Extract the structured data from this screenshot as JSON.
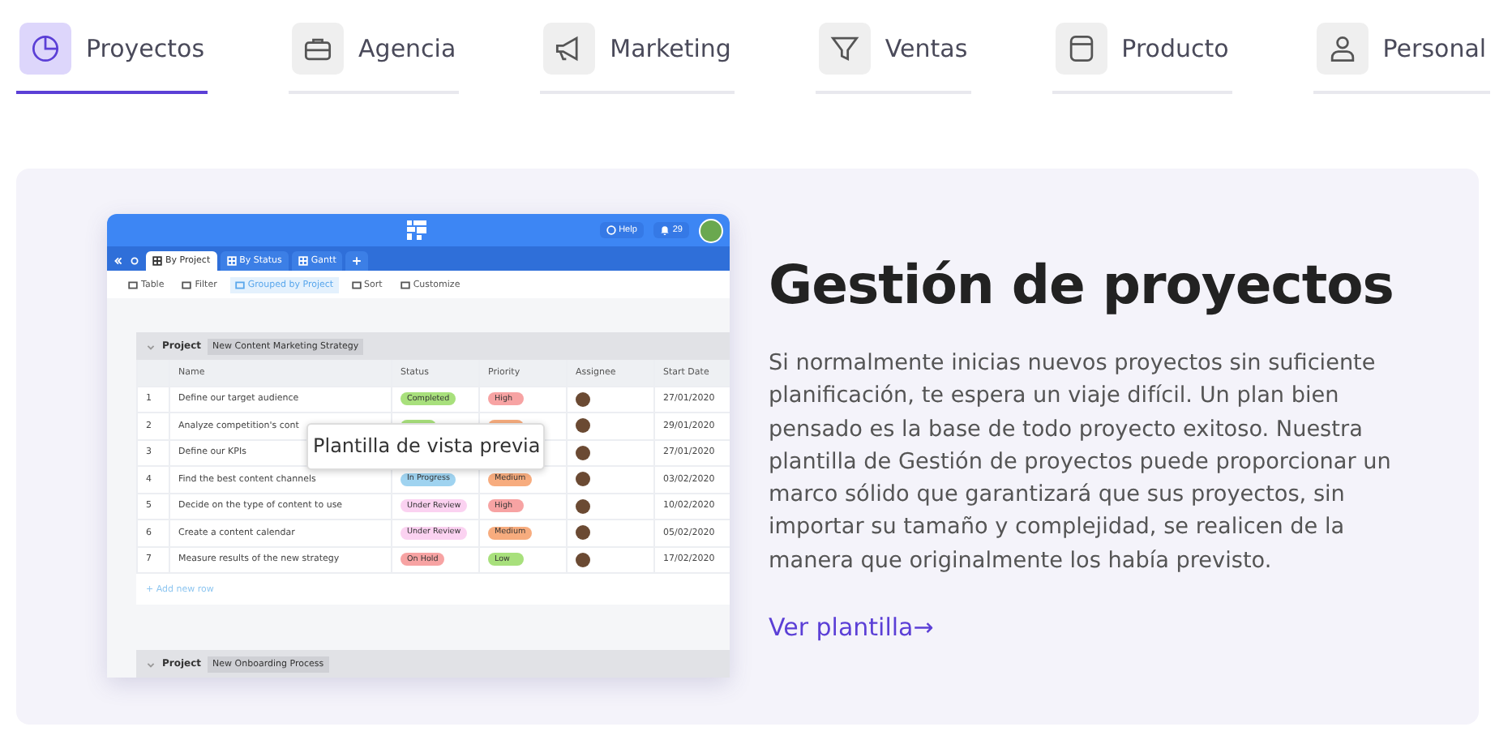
{
  "tabs": [
    {
      "label": "Proyectos",
      "selected": true
    },
    {
      "label": "Agencia",
      "selected": false
    },
    {
      "label": "Marketing",
      "selected": false
    },
    {
      "label": "Ventas",
      "selected": false
    },
    {
      "label": "Producto",
      "selected": false
    },
    {
      "label": "Personal",
      "selected": false
    }
  ],
  "preview": {
    "header": {
      "help": "Help",
      "notifications": "29"
    },
    "view_tabs": [
      {
        "label": "By Project",
        "selected": true
      },
      {
        "label": "By Status",
        "selected": false
      },
      {
        "label": "Gantt",
        "selected": false
      }
    ],
    "toolbar": [
      {
        "label": "Table",
        "selected": false
      },
      {
        "label": "Filter",
        "selected": false
      },
      {
        "label": "Grouped by Project",
        "selected": true
      },
      {
        "label": "Sort",
        "selected": false
      },
      {
        "label": "Customize",
        "selected": false
      }
    ],
    "groups": [
      {
        "label": "Project",
        "name": "New Content Marketing Strategy",
        "columns": [
          "Name",
          "Status",
          "Priority",
          "Assignee",
          "Start Date"
        ],
        "rows": [
          {
            "number": "1",
            "name": "Define our target audience",
            "status": {
              "label": "Completed",
              "color": "#a8e07c"
            },
            "priority": {
              "label": "High",
              "color": "#f7a3a3"
            },
            "start_date": "27/01/2020"
          },
          {
            "number": "2",
            "name": "Analyze competition's cont",
            "status": {
              "color": "#a8e07c"
            },
            "priority": {
              "color": "#f7ac7e"
            },
            "start_date": "29/01/2020"
          },
          {
            "number": "3",
            "name": "Define our KPIs",
            "start_date": "27/01/2020"
          },
          {
            "number": "4",
            "name": "Find the best content channels",
            "status": {
              "label": "In Progress",
              "color": "#9fd3f0"
            },
            "priority": {
              "label": "Medium",
              "color": "#f7ac7e"
            },
            "start_date": "03/02/2020"
          },
          {
            "number": "5",
            "name": "Decide on the type of content to use",
            "status": {
              "label": "Under Review",
              "color": "#fbd2f1"
            },
            "priority": {
              "label": "High",
              "color": "#f7a3a3"
            },
            "start_date": "10/02/2020"
          },
          {
            "number": "6",
            "name": "Create a content calendar",
            "status": {
              "label": "Under Review",
              "color": "#fbd2f1"
            },
            "priority": {
              "label": "Medium",
              "color": "#f7ac7e"
            },
            "start_date": "05/02/2020"
          },
          {
            "number": "7",
            "name": "Measure results of the new strategy",
            "status": {
              "label": "On Hold",
              "color": "#f7a3a3"
            },
            "priority": {
              "label": "Low",
              "color": "#a8e07c"
            },
            "start_date": "17/02/2020"
          }
        ],
        "add_row": "+ Add new row"
      },
      {
        "label": "Project",
        "name": "New Onboarding Process"
      }
    ],
    "tooltip": "Plantilla de vista previa"
  },
  "info": {
    "title": "Gestión de proyectos",
    "body": "Si normalmente inicias nuevos proyectos sin suficiente planificación, te espera un viaje difícil. Un plan bien pensado es la base de todo proyecto exitoso. Nuestra plantilla de Gestión de proyectos puede proporcionar un marco sólido que garantizará que sus proyectos, sin importar su tamaño y complejidad, se realicen de la manera que originalmente los había previsto.",
    "link": "Ver plantilla→"
  }
}
